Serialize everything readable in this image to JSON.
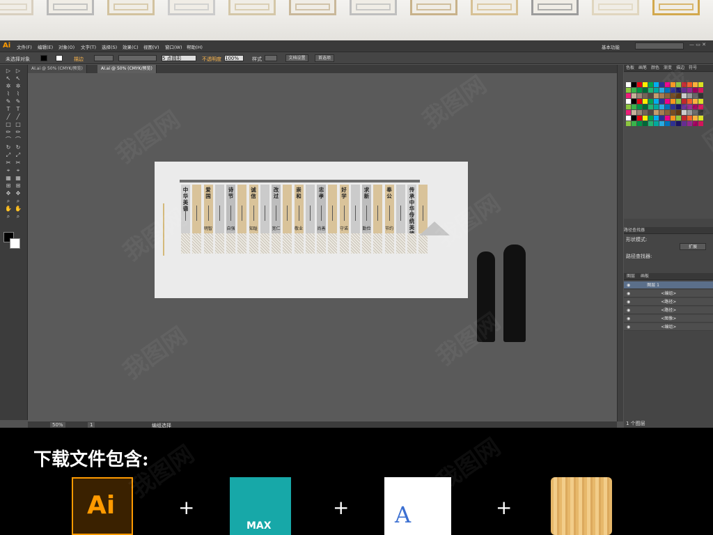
{
  "menubar": {
    "logo": "Ai",
    "items": [
      "文件(F)",
      "编辑(E)",
      "对象(O)",
      "文字(T)",
      "选择(S)",
      "效果(C)",
      "视图(V)",
      "窗口(W)",
      "帮助(H)"
    ],
    "workspace": "基本功能"
  },
  "controlbar": {
    "selection": "未选择对象",
    "stroke_label": "描边",
    "size": "5 点圆形",
    "opacity_label": "不透明度",
    "opacity": "100%",
    "style_label": "样式",
    "doc_setup": "文档设置",
    "prefs": "首选项"
  },
  "tabs": [
    {
      "label": "AI.ai @ 50% (CMYK/预览)"
    },
    {
      "label": "AI.ai @ 50% (CMYK/预览)"
    }
  ],
  "status": {
    "zoom": "50%",
    "page": "1",
    "tool": "编组选择"
  },
  "panels": {
    "tabs": [
      "色板",
      "画笔",
      "颜色",
      "渐变",
      "描边",
      "符号"
    ],
    "pathfinder": {
      "title": "路径查找器",
      "shape_mode": "形状模式:",
      "expand": "扩展",
      "pathfinder_label": "路径查找器:"
    },
    "layers": {
      "tabs": [
        "图层",
        "画板"
      ],
      "count": "1 个图层",
      "rows": [
        {
          "name": "图层 1"
        },
        {
          "name": "<编组>"
        },
        {
          "name": "<路径>"
        },
        {
          "name": "<路径>"
        },
        {
          "name": "<图像>"
        },
        {
          "name": "<编组>"
        }
      ]
    }
  },
  "artwork": {
    "panels": [
      {
        "title": "中华美德",
        "sub": "",
        "color": "#cfcfcf"
      },
      {
        "title": "爱国",
        "sub": "明智",
        "color": "#d9c39a"
      },
      {
        "title": "诗节",
        "sub": "自强",
        "color": "#bdbdbd"
      },
      {
        "title": "诚信",
        "sub": "知耻",
        "color": "#d9c39a"
      },
      {
        "title": "改过",
        "sub": "宽仁",
        "color": "#bdbdbd"
      },
      {
        "title": "崇和",
        "sub": "敬业",
        "color": "#d9c39a"
      },
      {
        "title": "忠孝",
        "sub": "尚善",
        "color": "#bdbdbd"
      },
      {
        "title": "好学",
        "sub": "守诺",
        "color": "#d9c39a"
      },
      {
        "title": "求新",
        "sub": "勤俭",
        "color": "#bdbdbd"
      },
      {
        "title": "奉公",
        "sub": "节约",
        "color": "#d9c39a"
      },
      {
        "title": "传承中华传统美德",
        "sub": "",
        "color": "#cfcfcf"
      }
    ]
  },
  "download": {
    "title": "下载文件包含:",
    "items": [
      {
        "label": "Ai"
      },
      {
        "label": "MAX"
      },
      {
        "label": "A"
      },
      {
        "label": "wood"
      }
    ],
    "plus": "+"
  },
  "watermark": "我图网"
}
